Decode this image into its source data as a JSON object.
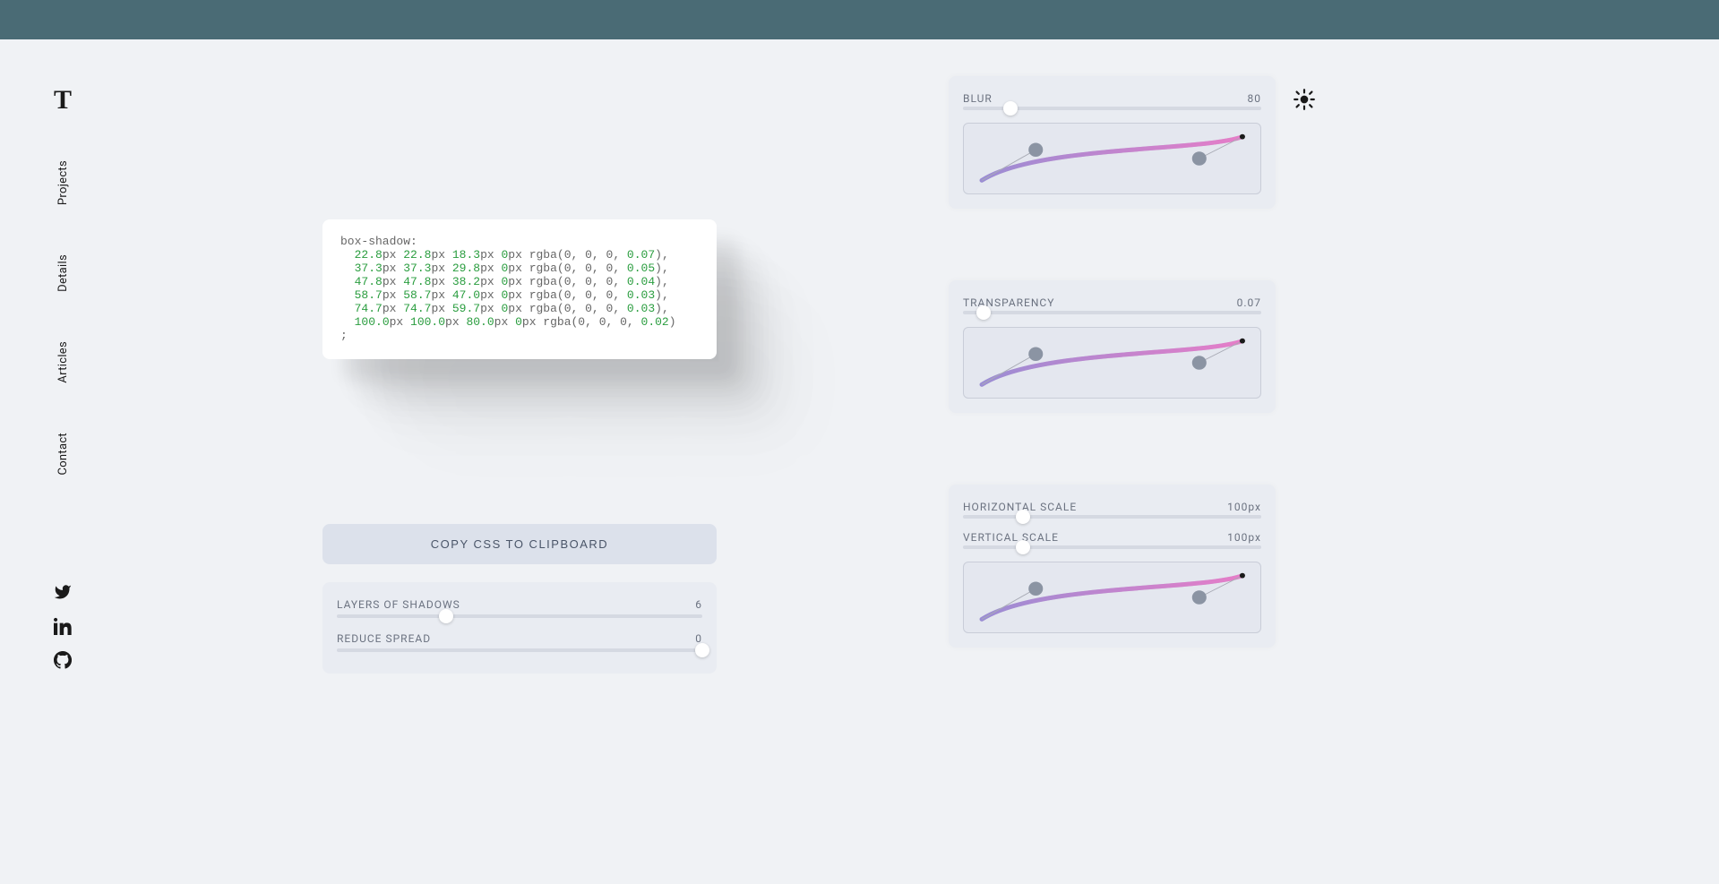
{
  "nav": {
    "logo": "T",
    "items": [
      "Projects",
      "Details",
      "Articles",
      "Contact"
    ]
  },
  "code": {
    "prefix": "box-shadow:",
    "lines": [
      {
        "x": "22.8",
        "y": "22.8",
        "b": "18.3",
        "s": "0",
        "a": "0.07"
      },
      {
        "x": "37.3",
        "y": "37.3",
        "b": "29.8",
        "s": "0",
        "a": "0.05"
      },
      {
        "x": "47.8",
        "y": "47.8",
        "b": "38.2",
        "s": "0",
        "a": "0.04"
      },
      {
        "x": "58.7",
        "y": "58.7",
        "b": "47.0",
        "s": "0",
        "a": "0.03"
      },
      {
        "x": "74.7",
        "y": "74.7",
        "b": "59.7",
        "s": "0",
        "a": "0.03"
      },
      {
        "x": "100.0",
        "y": "100.0",
        "b": "80.0",
        "s": "0",
        "a": "0.02"
      }
    ],
    "suffix": ";"
  },
  "copyButton": "COPY CSS TO CLIPBOARD",
  "bottom": {
    "layers": {
      "label": "LAYERS OF SHADOWS",
      "value": "6",
      "pos": 30
    },
    "spread": {
      "label": "REDUCE SPREAD",
      "value": "0",
      "pos": 100
    }
  },
  "panels": {
    "blur": {
      "label": "BLUR",
      "value": "80",
      "sliderPos": 16
    },
    "transparency": {
      "label": "TRANSPARENCY",
      "value": "0.07",
      "sliderPos": 7
    },
    "scale": {
      "h": {
        "label": "HORIZONTAL SCALE",
        "value": "100px",
        "sliderPos": 20
      },
      "v": {
        "label": "VERTICAL SCALE",
        "value": "100px",
        "sliderPos": 20
      }
    }
  },
  "colors": {
    "curveStart": "#9b8dd4",
    "curveEnd": "#e67dc8"
  }
}
